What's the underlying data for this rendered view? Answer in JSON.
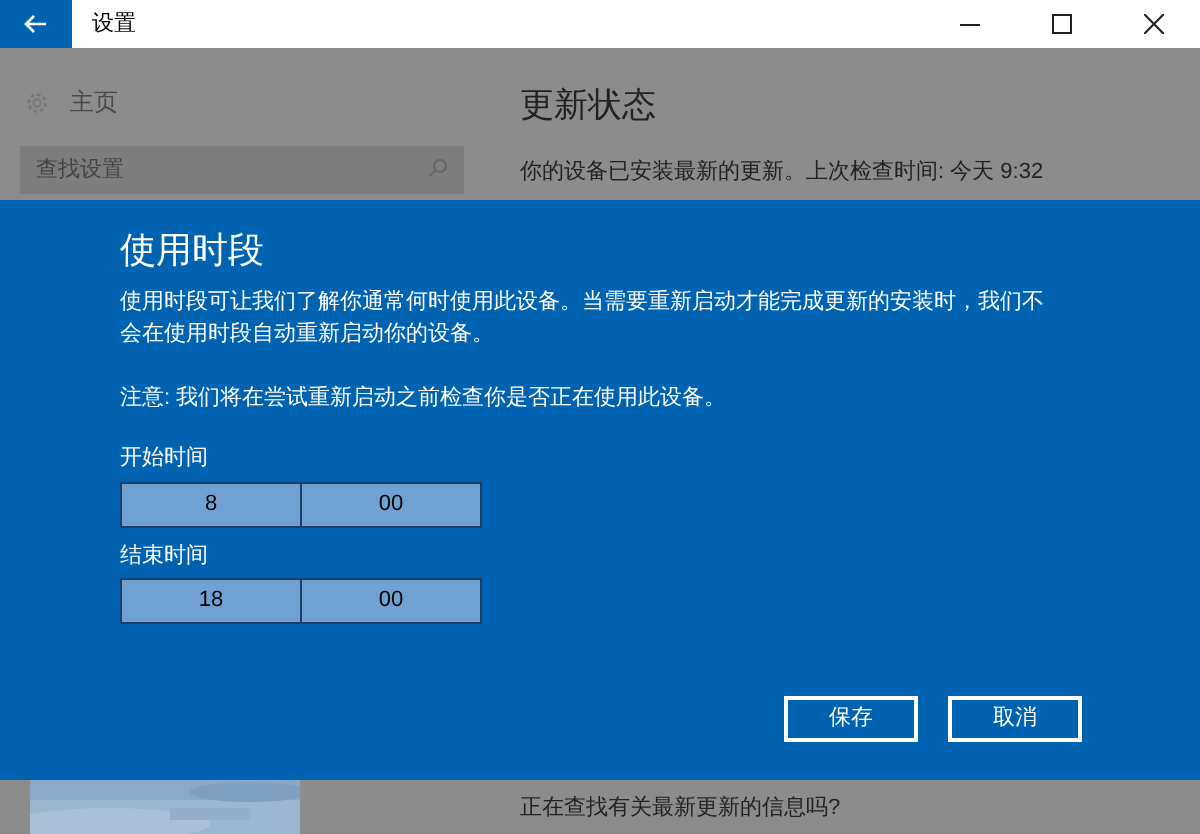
{
  "window": {
    "title": "设置"
  },
  "sidebar": {
    "home": "主页",
    "search": {
      "placeholder": "查找设置"
    }
  },
  "main": {
    "heading": "更新状态",
    "status": "你的设备已安装最新的更新。上次检查时间: 今天 9:32",
    "bottom_text": "正在查找有关最新更新的信息吗?"
  },
  "dialog": {
    "title": "使用时段",
    "description": "使用时段可让我们了解你通常何时使用此设备。当需要重新启动才能完成更新的安装时，我们不会在使用时段自动重新启动你的设备。",
    "note": "注意: 我们将在尝试重新启动之前检查你是否正在使用此设备。",
    "times": [
      {
        "label": "开始时间",
        "hour": "8",
        "minute": "00"
      },
      {
        "label": "结束时间",
        "hour": "18",
        "minute": "00"
      }
    ],
    "buttons": [
      "保存",
      "取消"
    ]
  }
}
